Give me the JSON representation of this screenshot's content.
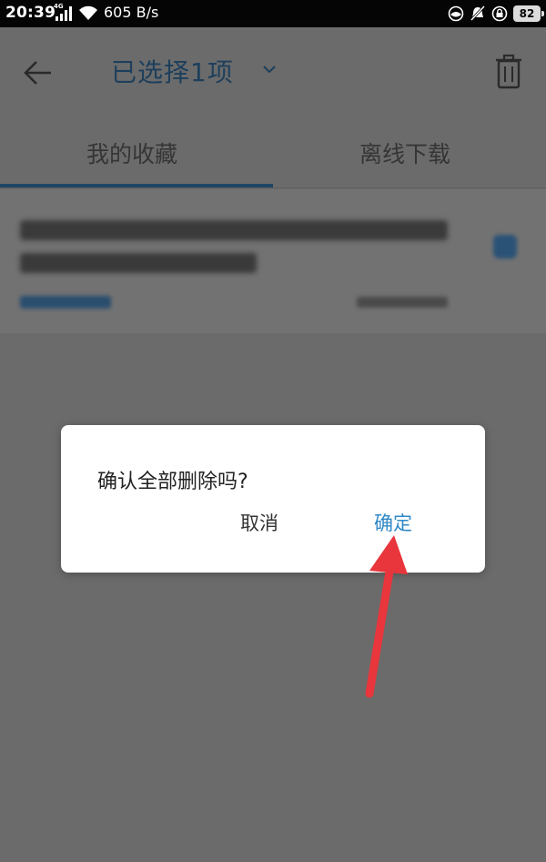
{
  "status_bar": {
    "time": "20:39",
    "network_label": "4G",
    "net_speed": "605 B/s",
    "battery": "82",
    "icons": [
      "signal-icon",
      "wifi-icon",
      "eye-care-icon",
      "mute-bell-icon",
      "lock-rotation-icon",
      "battery-icon"
    ]
  },
  "header": {
    "title": "已选择1项",
    "icons": [
      "back-arrow-icon",
      "chevron-down-icon",
      "trash-icon"
    ]
  },
  "tabs": [
    {
      "label": "我的收藏",
      "active": true
    },
    {
      "label": "离线下载",
      "active": false
    }
  ],
  "dialog": {
    "message": "确认全部删除吗?",
    "cancel_label": "取消",
    "confirm_label": "确定"
  },
  "colors": {
    "accent": "#2f88c6",
    "overlay_bg": "#6b6b6b",
    "annotation_arrow": "#e8363c"
  }
}
